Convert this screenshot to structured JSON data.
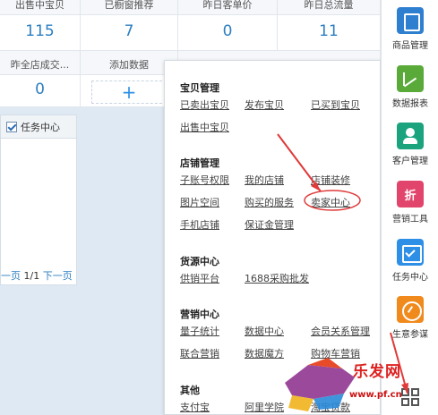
{
  "stats": {
    "row1_labels": [
      "出售中宝贝",
      "已橱窗推荐",
      "昨日客单价",
      "昨日总流量"
    ],
    "row1_values": [
      "115",
      "7",
      "0",
      "11"
    ],
    "row2_labels": [
      "昨全店成交...",
      "添加数据"
    ],
    "row2_values": [
      "0",
      "+"
    ]
  },
  "task_panel": {
    "title": "任务中心",
    "pager_prev": "一页",
    "pager_pages": "1/1",
    "pager_next": "下一页"
  },
  "menu": {
    "sections": [
      {
        "title": "宝贝管理",
        "links": [
          "已卖出宝贝",
          "发布宝贝",
          "已买到宝贝",
          "出售中宝贝"
        ]
      },
      {
        "title": "店铺管理",
        "links": [
          "子账号权限",
          "我的店铺",
          "店铺装修",
          "图片空间",
          "购买的服务",
          "卖家中心",
          "手机店铺",
          "保证金管理"
        ]
      },
      {
        "title": "货源中心",
        "links": [
          "供销平台",
          "1688采购批发"
        ]
      },
      {
        "title": "营销中心",
        "links": [
          "量子统计",
          "数据中心",
          "会员关系管理",
          "联合营销",
          "数据魔方",
          "购物车营销"
        ]
      },
      {
        "title": "其他",
        "links": [
          "支付宝",
          "阿里学院",
          "淘宝贷款"
        ]
      }
    ]
  },
  "sidebar": {
    "items": [
      {
        "label": "商品管理",
        "icon": "goods-icon",
        "color": "#2f7fd1"
      },
      {
        "label": "数据报表",
        "icon": "chart-icon",
        "color": "#5aaa3a"
      },
      {
        "label": "客户管理",
        "icon": "customer-icon",
        "color": "#1aa37d"
      },
      {
        "label": "营销工具",
        "icon": "discount-icon",
        "color": "#e2456b"
      },
      {
        "label": "任务中心",
        "icon": "task-icon",
        "color": "#2d8fe6"
      },
      {
        "label": "生意参谋",
        "icon": "compass-icon",
        "color": "#f08a1c"
      },
      {
        "label": "",
        "icon": "apps-grid-icon",
        "color": "#ffffff"
      }
    ]
  },
  "watermark": {
    "text": "乐发网",
    "url": "www.pf.cn"
  },
  "colors": {
    "accent": "#2d7fc1",
    "annotation": "#e03a3a",
    "page_bg": "#dfe9f3"
  }
}
